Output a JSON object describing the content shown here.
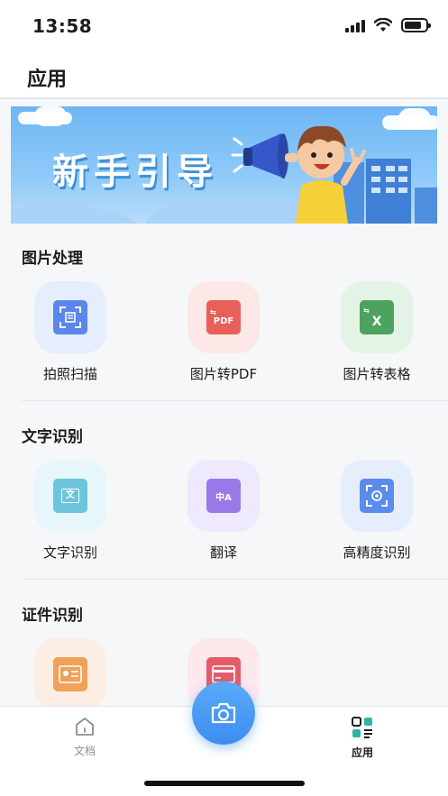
{
  "status_bar": {
    "time": "13:58",
    "icons": [
      "cellular-signal-icon",
      "wifi-icon",
      "battery-icon"
    ]
  },
  "header": {
    "title": "应用"
  },
  "banner": {
    "text": "新手引导"
  },
  "sections": [
    {
      "title": "图片处理",
      "items": [
        {
          "label": "拍照扫描",
          "icon": "scan-icon",
          "tile_bg": "#e6edfd",
          "icon_color": "#5b86ec",
          "glyph": ""
        },
        {
          "label": "图片转PDF",
          "icon": "pdf-icon",
          "tile_bg": "#fde8e8",
          "icon_color": "#e9605a",
          "glyph": "PDF"
        },
        {
          "label": "图片转表格",
          "icon": "excel-icon",
          "tile_bg": "#e3f4e6",
          "icon_color": "#4ea25f",
          "glyph": "X"
        }
      ]
    },
    {
      "title": "文字识别",
      "items": [
        {
          "label": "文字识别",
          "icon": "text-recognition-icon",
          "tile_bg": "#e6f6fb",
          "icon_color": "#6cc5dc",
          "glyph": "文"
        },
        {
          "label": "翻译",
          "icon": "translate-icon",
          "tile_bg": "#efe9fd",
          "icon_color": "#9b78e8",
          "glyph": "中A"
        },
        {
          "label": "高精度识别",
          "icon": "precision-recognition-icon",
          "tile_bg": "#e6eefd",
          "icon_color": "#5a8cec",
          "glyph": ""
        }
      ]
    },
    {
      "title": "证件识别",
      "items": [
        {
          "label": "",
          "icon": "id-card-icon",
          "tile_bg": "#fdeee3",
          "icon_color": "#f0a15a",
          "glyph": ""
        },
        {
          "label": "",
          "icon": "bank-card-icon",
          "tile_bg": "#fde8ec",
          "icon_color": "#e45c6c",
          "glyph": ""
        }
      ]
    }
  ],
  "tab_bar": {
    "tabs": [
      {
        "label": "文档",
        "icon": "document-home-icon",
        "active": false
      },
      {
        "label": "应用",
        "icon": "apps-grid-icon",
        "active": true
      }
    ],
    "camera_icon": "camera-icon"
  },
  "colors": {
    "accent": "#3d8df2",
    "active_tab": "#1c1c1e",
    "inactive_tab": "#8e8e93"
  }
}
